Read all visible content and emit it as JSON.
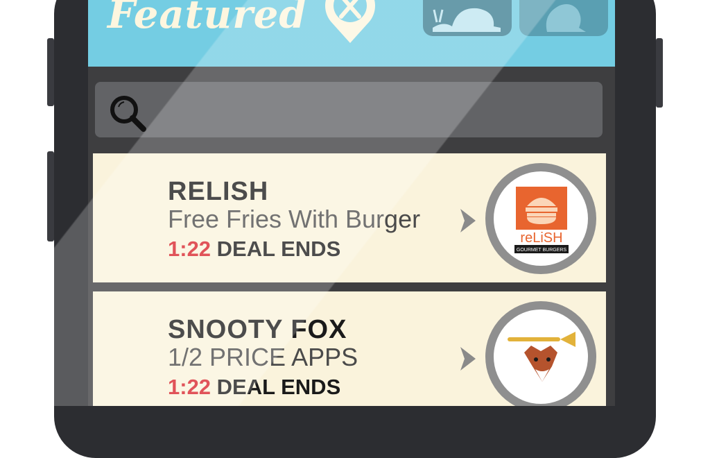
{
  "header": {
    "title": "Featured",
    "icons": [
      "map-pin-icon",
      "snail-icon",
      "seal-icon"
    ],
    "colors": {
      "background": "#74cde3",
      "cat_dark": "#3e7f92",
      "cat_light": "#5a9fb2"
    }
  },
  "search": {
    "placeholder": "",
    "icon": "search-icon"
  },
  "deals": [
    {
      "name": "RELISH",
      "offer": "Free Fries With Burger",
      "time": "1:22",
      "ends_label": "DEAL ENDS",
      "logo": {
        "line1": "reLiSH",
        "line2": "GOURMET BURGERS"
      }
    },
    {
      "name": "SNOOTY FOX",
      "offer": "1/2 PRICE APPS",
      "time": "1:22",
      "ends_label": "DEAL ENDS",
      "logo": {
        "icon": "fox-with-horn-icon"
      }
    }
  ],
  "colors": {
    "card": "#faf3dc",
    "accent_red": "#d8232a",
    "screen": "#3e3e40"
  }
}
